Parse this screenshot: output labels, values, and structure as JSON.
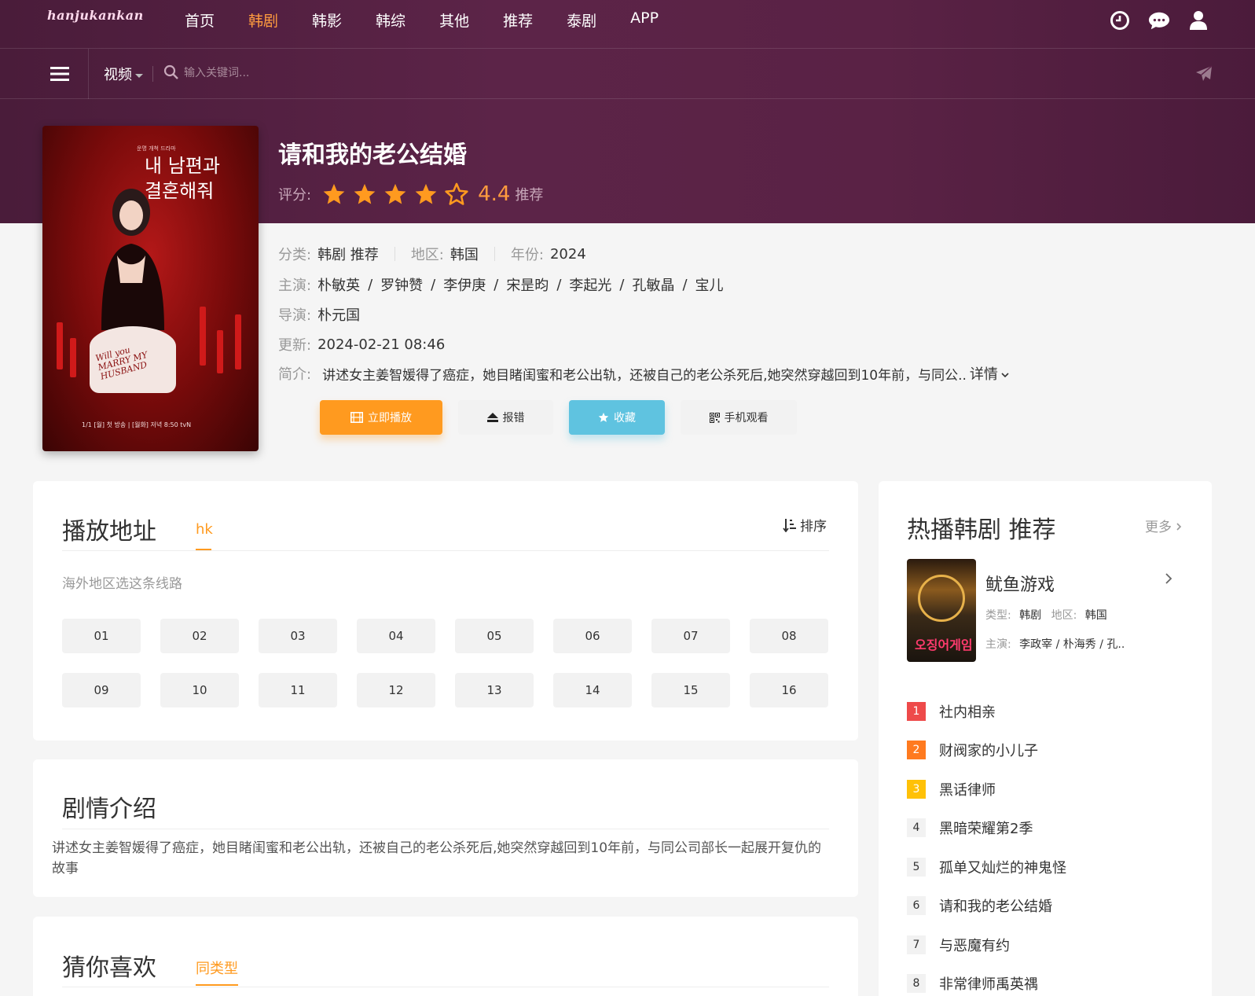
{
  "nav": {
    "logo": "hanjukankan",
    "links": [
      "首页",
      "韩剧",
      "韩影",
      "韩综",
      "其他",
      "推荐",
      "泰剧",
      "APP"
    ],
    "active_index": 1
  },
  "search": {
    "channel": "视频",
    "placeholder": "输入关键词..."
  },
  "poster": {
    "title_line1": "내 남편과",
    "title_line2": "결혼해줘",
    "subtitle": "운명 개척 드라마",
    "cake_line1": "Will you",
    "cake_line2": "MARRY MY",
    "cake_line3": "HUSBAND",
    "bottom_text": "1/1 [월] 첫 방송 | [월화] 저녁 8:50 tvN"
  },
  "show": {
    "title": "请和我的老公结婚",
    "rating_label": "评分:",
    "score": "4.4",
    "stars_filled": 4,
    "stars_total": 5,
    "recommend": "推荐",
    "category_label": "分类:",
    "category": "韩剧 推荐",
    "region_label": "地区:",
    "region": "韩国",
    "year_label": "年份:",
    "year": "2024",
    "cast_label": "主演:",
    "cast": [
      "朴敏英",
      "罗钟赞",
      "李伊庚",
      "宋昰昀",
      "李起光",
      "孔敏晶",
      "宝儿"
    ],
    "director_label": "导演:",
    "director": "朴元国",
    "update_label": "更新:",
    "update": "2024-02-21 08:46",
    "intro_label": "简介:",
    "intro_short": "讲述女主姜智媛得了癌症，她目睹闺蜜和老公出轨，还被自己的老公杀死后,她突然穿越回到10年前，与同公..",
    "more_label": "详情"
  },
  "buttons": {
    "play": "立即播放",
    "report": "报错",
    "favorite": "收藏",
    "mobile": "手机观看"
  },
  "playlist": {
    "title": "播放地址",
    "tab": "hk",
    "sort": "排序",
    "hint": "海外地区选这条线路",
    "episodes": [
      "01",
      "02",
      "03",
      "04",
      "05",
      "06",
      "07",
      "08",
      "09",
      "10",
      "11",
      "12",
      "13",
      "14",
      "15",
      "16"
    ]
  },
  "plot": {
    "title": "剧情介绍",
    "text": "讲述女主姜智媛得了癌症，她目睹闺蜜和老公出轨，还被自己的老公杀死后,她突然穿越回到10年前，与同公司部长一起展开复仇的故事"
  },
  "guess": {
    "title": "猜你喜欢",
    "tab": "同类型"
  },
  "sidebar": {
    "title": "热播韩剧 推荐",
    "more": "更多",
    "featured": {
      "title": "鱿鱼游戏",
      "thumb_text": "오징어게임",
      "type_label": "类型:",
      "type": "韩剧",
      "region_label": "地区:",
      "region": "韩国",
      "cast_label": "主演:",
      "cast": "李政宰 / 朴海秀 / 孔.."
    },
    "ranking": [
      {
        "num": "1",
        "title": "社内相亲"
      },
      {
        "num": "2",
        "title": "财阀家的小儿子"
      },
      {
        "num": "3",
        "title": "黑话律师"
      },
      {
        "num": "4",
        "title": "黑暗荣耀第2季"
      },
      {
        "num": "5",
        "title": "孤单又灿烂的神鬼怪"
      },
      {
        "num": "6",
        "title": "请和我的老公结婚"
      },
      {
        "num": "7",
        "title": "与恶魔有约"
      },
      {
        "num": "8",
        "title": "非常律师禹英禑"
      }
    ]
  },
  "colors": {
    "header_bg": "#5c2448",
    "accent": "#ff9a1f",
    "favorite": "#5fc3e0"
  }
}
